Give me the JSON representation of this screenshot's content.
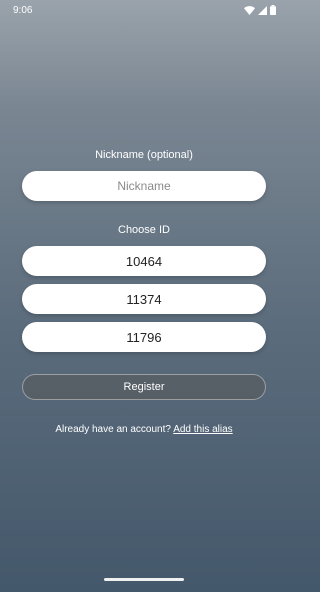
{
  "status_bar": {
    "time": "9:06",
    "icons": [
      "wifi-icon",
      "signal-icon",
      "battery-icon"
    ]
  },
  "form": {
    "nickname_label": "Nickname (optional)",
    "nickname_placeholder": "Nickname",
    "nickname_value": "",
    "choose_id_label": "Choose ID",
    "id_options": [
      "10464",
      "11374",
      "11796"
    ],
    "register_label": "Register",
    "footer_text": "Already have an account?",
    "footer_link": "Add this alias"
  },
  "colors": {
    "background_top": "#9aa3ab",
    "background_bottom": "#44586b",
    "pill_background": "#ffffff",
    "text_light": "#ffffff"
  }
}
